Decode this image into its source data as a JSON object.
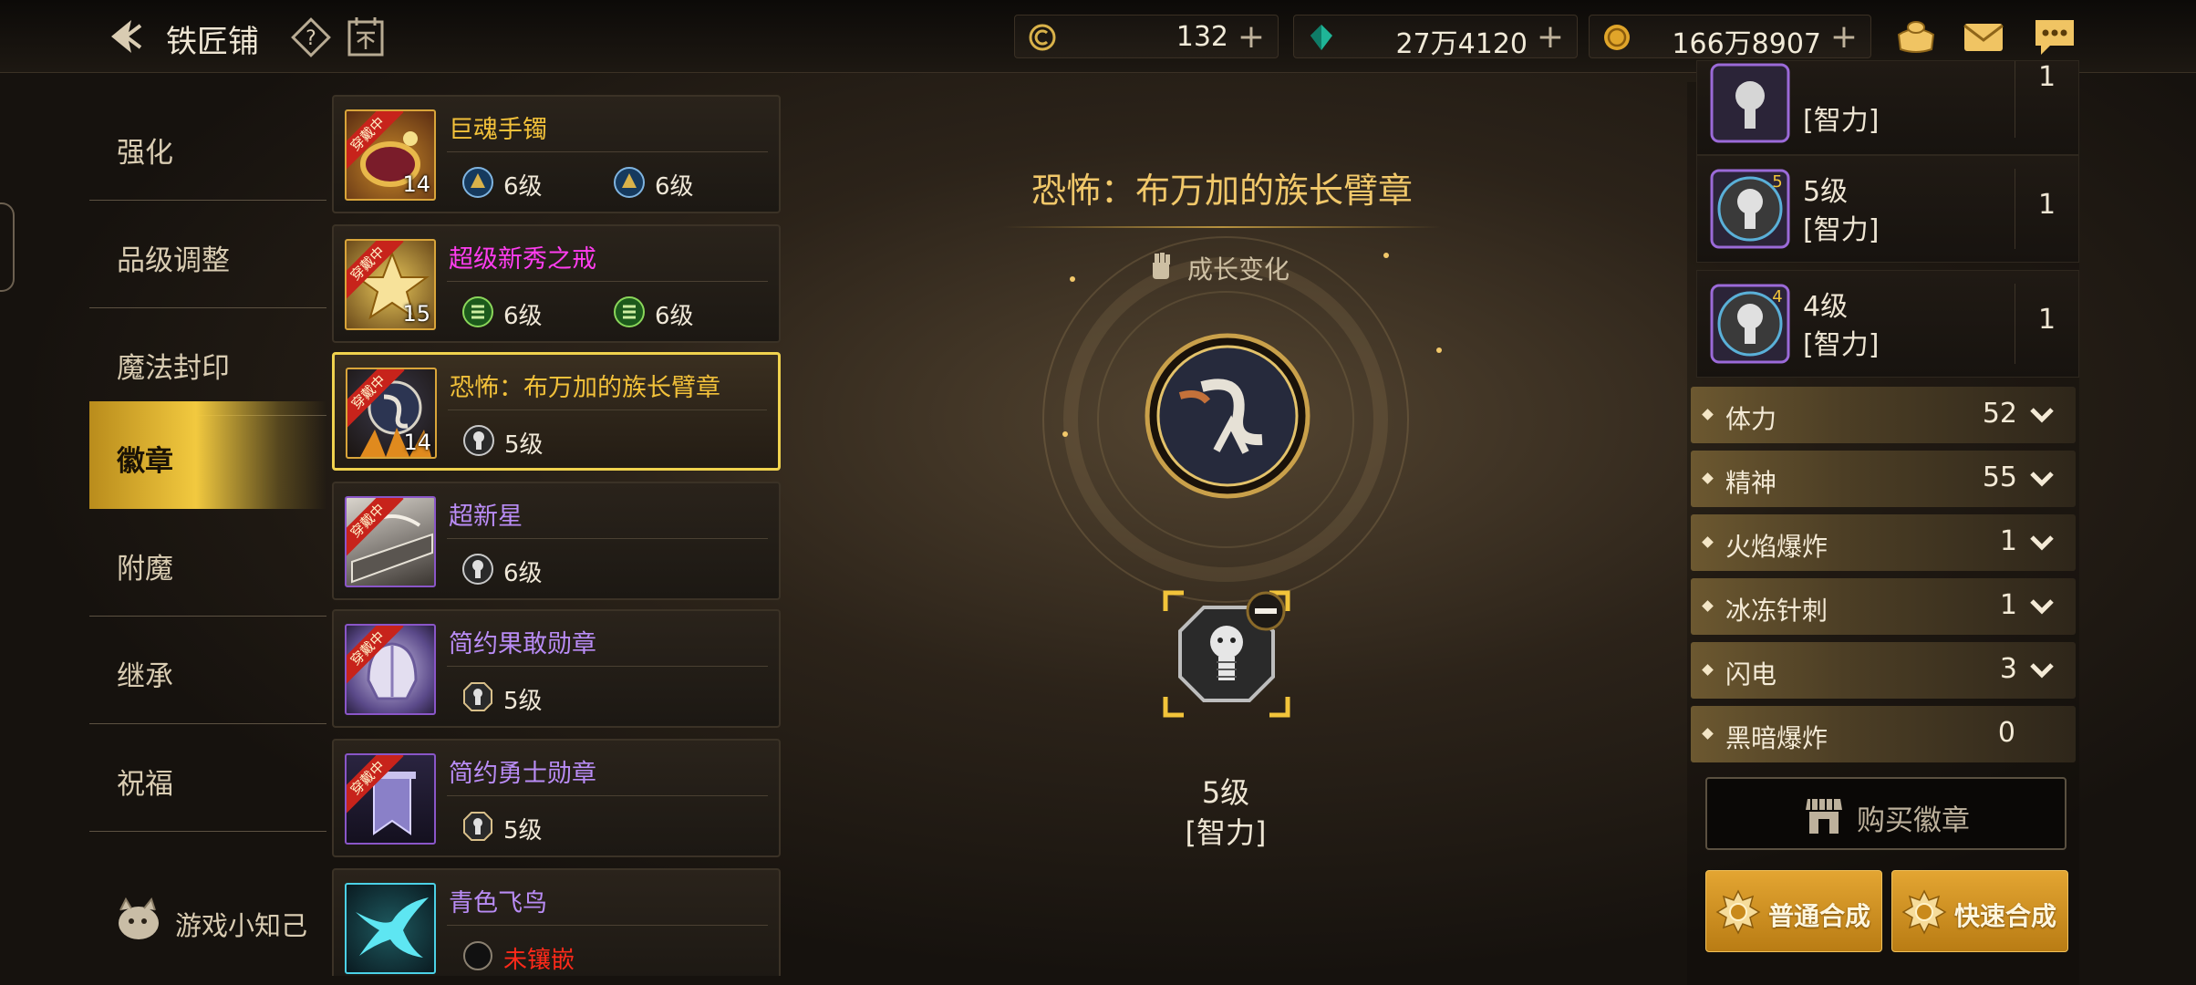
{
  "header": {
    "title": "铁匠铺",
    "currencies": [
      {
        "icon": "silver-coin-icon",
        "value": "132"
      },
      {
        "icon": "green-crystal-icon",
        "value": "27万4120"
      },
      {
        "icon": "gold-coin-icon",
        "value": "166万8907"
      }
    ],
    "plus": "+"
  },
  "nav": {
    "items": [
      {
        "label": "强化",
        "active": false
      },
      {
        "label": "品级调整",
        "active": false
      },
      {
        "label": "魔法封印",
        "active": false
      },
      {
        "label": "徽章",
        "active": true
      },
      {
        "label": "附魔",
        "active": false
      },
      {
        "label": "继承",
        "active": false
      },
      {
        "label": "祝福",
        "active": false
      }
    ],
    "trivia_label": "游戏小知己"
  },
  "items": [
    {
      "name": "巨魂手镯",
      "name_color": "#f2c13a",
      "badge": "穿戴中",
      "level": "14",
      "slots": [
        {
          "icon": "blue-emblem-icon",
          "label": "6级"
        },
        {
          "icon": "blue-emblem-icon",
          "label": "6级"
        }
      ]
    },
    {
      "name": "超级新秀之戒",
      "name_color": "#ff3df0",
      "badge": "穿戴中",
      "level": "15",
      "slots": [
        {
          "icon": "green-emblem-icon",
          "label": "6级"
        },
        {
          "icon": "green-emblem-icon",
          "label": "6级"
        }
      ]
    },
    {
      "name": "恐怖：布万加的族长臂章",
      "name_color": "#f2c13a",
      "badge": "穿戴中",
      "level": "14",
      "selected": true,
      "slots": [
        {
          "icon": "platinum-emblem-icon",
          "label": "5级"
        }
      ]
    },
    {
      "name": "超新星",
      "name_color": "#b98cf5",
      "badge": "穿戴中",
      "level": "",
      "slots": [
        {
          "icon": "platinum-emblem-icon",
          "label": "6级"
        }
      ]
    },
    {
      "name": "简约果敢勋章",
      "name_color": "#b98cf5",
      "badge": "穿戴中",
      "level": "",
      "slots": [
        {
          "icon": "octagon-emblem-icon",
          "label": "5级"
        }
      ]
    },
    {
      "name": "简约勇士勋章",
      "name_color": "#b98cf5",
      "badge": "穿戴中",
      "level": "",
      "slots": [
        {
          "icon": "octagon-emblem-icon",
          "label": "5级"
        }
      ]
    },
    {
      "name": "青色飞鸟",
      "name_color": "#b98cf5",
      "badge": "",
      "level": "",
      "slots": [
        {
          "icon": "empty-slot-icon",
          "label": "未镶嵌",
          "color": "#ff2a1a"
        }
      ]
    }
  ],
  "center": {
    "title": "恐怖：布万加的族长臂章",
    "growth_label": "成长变化",
    "socket_level": "5级",
    "socket_attr": "[智力]"
  },
  "right": {
    "emblems": [
      {
        "level": "",
        "attr": "[智力]",
        "count": "1",
        "badge": ""
      },
      {
        "level": "5级",
        "attr": "[智力]",
        "count": "1",
        "badge": "5"
      },
      {
        "level": "4级",
        "attr": "[智力]",
        "count": "1",
        "badge": "4"
      }
    ],
    "stats": [
      {
        "name": "体力",
        "value": "52",
        "expandable": true
      },
      {
        "name": "精神",
        "value": "55",
        "expandable": true
      },
      {
        "name": "火焰爆炸",
        "value": "1",
        "expandable": true
      },
      {
        "name": "冰冻针刺",
        "value": "1",
        "expandable": true
      },
      {
        "name": "闪电",
        "value": "3",
        "expandable": true
      },
      {
        "name": "黑暗爆炸",
        "value": "0",
        "expandable": false
      }
    ],
    "buy_label": "购买徽章",
    "normal_synth_label": "普通合成",
    "quick_synth_label": "快速合成"
  },
  "colors": {
    "accent_gold": "#f2c93f",
    "selected_border": "#f0d24e",
    "error_red": "#ff2a1a"
  }
}
